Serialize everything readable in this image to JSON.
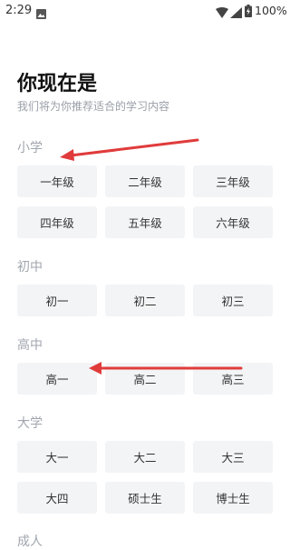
{
  "status_bar": {
    "time": "2:29",
    "battery": "100%",
    "icons": [
      "photo-icon",
      "wifi-icon",
      "signal-icon",
      "battery-icon"
    ]
  },
  "header": {
    "title": "你现在是",
    "subtitle": "我们将为你推荐适合的学习内容"
  },
  "sections": [
    {
      "label": "小学",
      "options": [
        "一年级",
        "二年级",
        "三年级",
        "四年级",
        "五年级",
        "六年级"
      ]
    },
    {
      "label": "初中",
      "options": [
        "初一",
        "初二",
        "初三"
      ]
    },
    {
      "label": "高中",
      "options": [
        "高一",
        "高二",
        "高三"
      ]
    },
    {
      "label": "大学",
      "options": [
        "大一",
        "大二",
        "大三",
        "大四",
        "硕士生",
        "博士生"
      ]
    },
    {
      "label": "成人"
    }
  ],
  "colors": {
    "option_bg": "#f3f4f6",
    "label": "#a0a6ae",
    "annotation_arrow": "#e03b3b"
  }
}
